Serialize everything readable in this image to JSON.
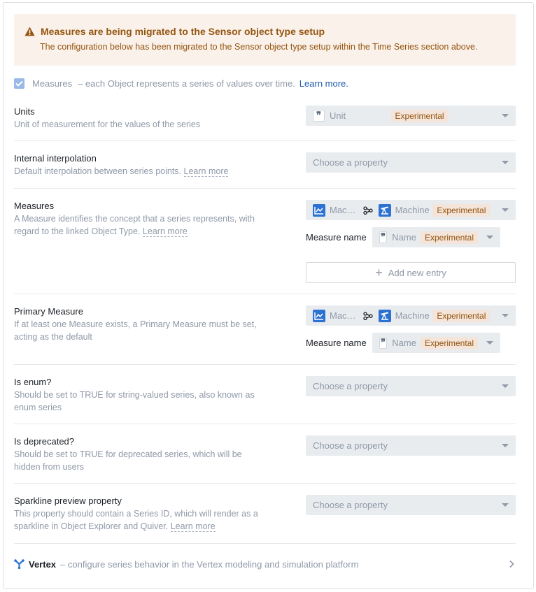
{
  "callout": {
    "icon": "warning-icon",
    "title": "Measures are being migrated to the Sensor object type setup",
    "body": "The configuration below has been migrated to the Sensor object type setup within the Time Series section above."
  },
  "measures_toggle": {
    "checked": true,
    "label": "Measures",
    "description": "– each Object represents a series of values over time.",
    "link": "Learn more."
  },
  "sections": {
    "units": {
      "title": "Units",
      "description": "Unit of measurement for the values of the series",
      "select": {
        "value": "Unit",
        "icon": "quote-icon",
        "tag": "Experimental"
      }
    },
    "interpolation": {
      "title": "Internal interpolation",
      "description": "Default interpolation between series points.",
      "link": "Learn more",
      "select": {
        "placeholder": "Choose a property"
      }
    },
    "measures": {
      "title": "Measures",
      "description": "A Measure identifies the concept that a series represents, with regard to the linked Object Type.",
      "link": "Learn more",
      "select": {
        "source": "Mac…",
        "target": "Machine",
        "tag": "Experimental"
      },
      "measure_name_label": "Measure name",
      "measure_name": {
        "value": "Name",
        "tag": "Experimental"
      },
      "add_button": "Add new entry"
    },
    "primary_measure": {
      "title": "Primary Measure",
      "description": "If at least one Measure exists, a Primary Measure must be set, acting as the default",
      "select": {
        "source": "Mac…",
        "target": "Machine",
        "tag": "Experimental"
      },
      "measure_name_label": "Measure name",
      "measure_name": {
        "value": "Name",
        "tag": "Experimental"
      }
    },
    "is_enum": {
      "title": "Is enum?",
      "description": "Should be set to TRUE for string-valued series, also known as enum series",
      "select": {
        "placeholder": "Choose a property"
      }
    },
    "is_deprecated": {
      "title": "Is deprecated?",
      "description": "Should be set to TRUE for deprecated series, which will be hidden from users",
      "select": {
        "placeholder": "Choose a property"
      }
    },
    "sparkline": {
      "title": "Sparkline preview property",
      "description": "This property should contain a Series ID, which will render as a sparkline in Object Explorer and Quiver.",
      "link": "Learn more",
      "select": {
        "placeholder": "Choose a property"
      }
    }
  },
  "vertex": {
    "name": "Vertex",
    "description": "– configure series behavior in the Vertex modeling and simulation platform"
  },
  "colors": {
    "warning": "#935610",
    "warning_bg": "#fbf1eb",
    "link": "#215db0",
    "object_icon": "#2d72d2",
    "muted_text": "#8f99a8"
  }
}
